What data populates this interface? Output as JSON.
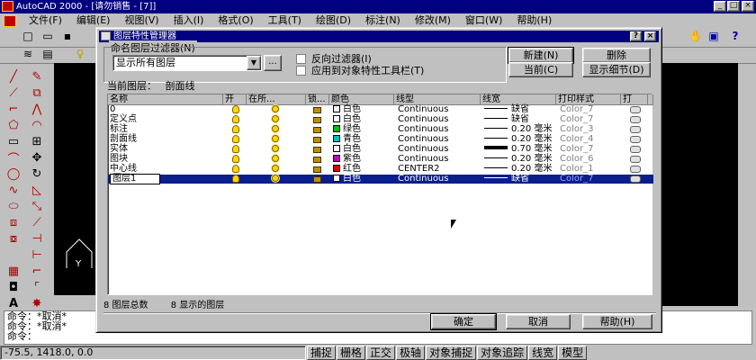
{
  "app": {
    "title": "AutoCAD 2000 - [请勿销售 - [7]]",
    "menu": [
      "文件(F)",
      "编辑(E)",
      "视图(V)",
      "插入(I)",
      "格式(O)",
      "工具(T)",
      "绘图(D)",
      "标注(N)",
      "修改(M)",
      "窗口(W)",
      "帮助(H)"
    ]
  },
  "dialog": {
    "title": "图层特性管理器",
    "filter_group_label": "命名图层过滤器(N)",
    "filter_value": "显示所有图层",
    "filter_dots": "...",
    "invert_filter_label": "反向过滤器(I)",
    "apply_toolbar_label": "应用到对象特性工具栏(T)",
    "btn_new": "新建(N)",
    "btn_delete": "删除",
    "btn_current": "当前(C)",
    "btn_show_details": "显示细节(D)",
    "current_layer_label": "当前图层：",
    "current_layer_value": "剖面线",
    "columns": [
      "名称",
      "开",
      "在所...",
      "锁...",
      "颜色",
      "线型",
      "线宽",
      "打印样式",
      "打"
    ],
    "rows": [
      {
        "name": "0",
        "color": "白色",
        "color_hex": "#ffffff",
        "linetype": "Continuous",
        "lineweight": "缺省",
        "plotstyle": "Color_7"
      },
      {
        "name": "定义点",
        "color": "白色",
        "color_hex": "#ffffff",
        "linetype": "Continuous",
        "lineweight": "缺省",
        "plotstyle": "Color_7"
      },
      {
        "name": "标注",
        "color": "绿色",
        "color_hex": "#00c000",
        "linetype": "Continuous",
        "lineweight": "0.20 毫米",
        "plotstyle": "Color_3"
      },
      {
        "name": "剖面线",
        "color": "青色",
        "color_hex": "#00c0c0",
        "linetype": "Continuous",
        "lineweight": "0.20 毫米",
        "plotstyle": "Color_4"
      },
      {
        "name": "实体",
        "color": "白色",
        "color_hex": "#ffffff",
        "linetype": "Continuous",
        "lineweight": "0.70 毫米",
        "plotstyle": "Color_7"
      },
      {
        "name": "图块",
        "color": "紫色",
        "color_hex": "#c000c0",
        "linetype": "Continuous",
        "lineweight": "0.20 毫米",
        "plotstyle": "Color_6"
      },
      {
        "name": "中心线",
        "color": "红色",
        "color_hex": "#e00000",
        "linetype": "CENTER2",
        "lineweight": "0.20 毫米",
        "plotstyle": "Color_1"
      },
      {
        "name": "图层1",
        "color": "白色",
        "color_hex": "#ffffff",
        "linetype": "Continuous",
        "lineweight": "缺省",
        "plotstyle": "Color_7"
      }
    ],
    "status_total": "8  图层总数",
    "status_shown": "8  显示的图层",
    "btn_ok": "确定",
    "btn_cancel": "取消",
    "btn_help": "帮助(H)"
  },
  "command": {
    "lines": [
      "命令：*取消*",
      "命令：*取消*",
      "命令："
    ]
  },
  "status": {
    "coords": "-75.5, 1418.0, 0.0",
    "toggles": [
      "捕捉",
      "栅格",
      "正交",
      "极轴",
      "对象捕捉",
      "对象追踪",
      "线宽",
      "模型"
    ]
  }
}
